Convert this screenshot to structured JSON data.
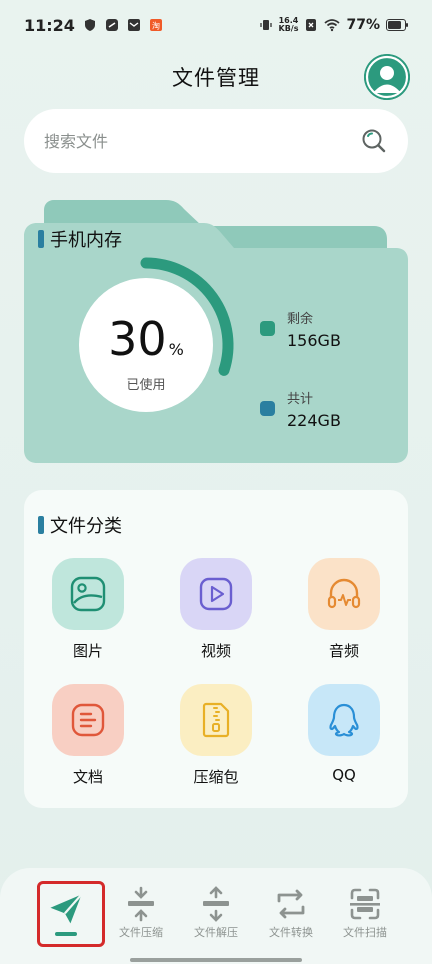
{
  "status": {
    "time": "11:24",
    "net_speed_value": "16.4",
    "net_speed_unit": "KB/s",
    "battery": "77%"
  },
  "header": {
    "title": "文件管理"
  },
  "search": {
    "placeholder": "搜索文件"
  },
  "storage": {
    "title": "手机内存",
    "used_percent": "30",
    "percent_sign": "%",
    "used_label": "已使用",
    "used_fraction": 0.3,
    "remaining_label": "剩余",
    "remaining_value": "156GB",
    "total_label": "共计",
    "total_value": "224GB"
  },
  "categories": {
    "title": "文件分类",
    "items": [
      {
        "label": "图片",
        "icon": "image-icon"
      },
      {
        "label": "视频",
        "icon": "video-icon"
      },
      {
        "label": "音频",
        "icon": "audio-icon"
      },
      {
        "label": "文档",
        "icon": "document-icon"
      },
      {
        "label": "压缩包",
        "icon": "zip-icon"
      },
      {
        "label": "QQ",
        "icon": "qq-icon"
      }
    ]
  },
  "nav": {
    "items": [
      {
        "label": "",
        "icon": "send-icon"
      },
      {
        "label": "文件压缩",
        "icon": "compress-icon"
      },
      {
        "label": "文件解压",
        "icon": "decompress-icon"
      },
      {
        "label": "文件转换",
        "icon": "convert-icon"
      },
      {
        "label": "文件扫描",
        "icon": "scan-icon"
      }
    ]
  },
  "colors": {
    "accent": "#2c9a7e",
    "folder": "#a9d6ca",
    "legend_remaining": "#2c9a7e",
    "legend_total": "#2a7fa0",
    "highlight_box": "#d42a2a"
  }
}
